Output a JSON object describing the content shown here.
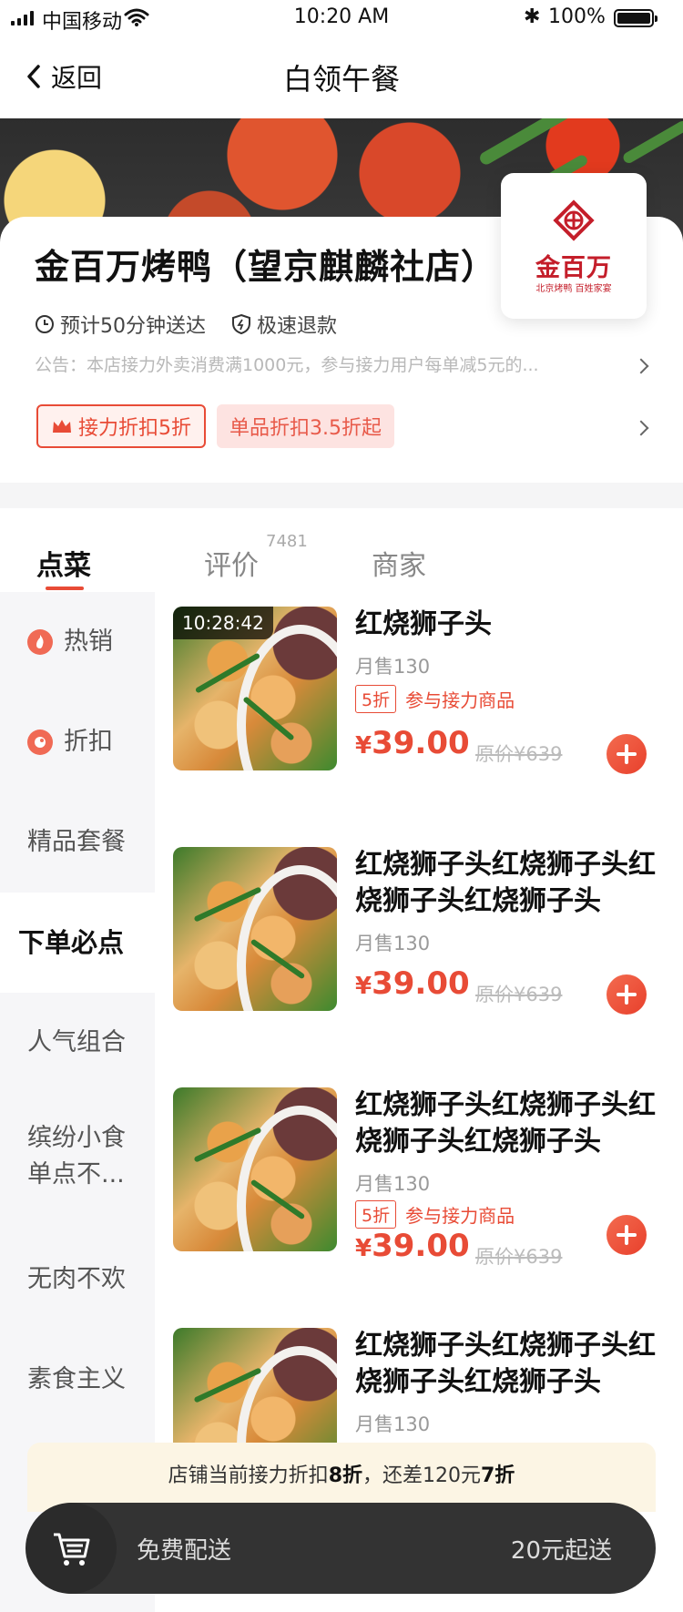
{
  "status_bar": {
    "carrier": "中国移动",
    "time": "10:20 AM",
    "battery": "100%"
  },
  "nav": {
    "back_label": "返回",
    "title": "白领午餐"
  },
  "store": {
    "name": "金百万烤鸭（望京麒麟社店）",
    "logo_text": "金百万",
    "logo_sub": "北京烤鸭 百姓家宴",
    "delivery_time": "预计50分钟送达",
    "refund": "极速退款",
    "notice": "公告：本店接力外卖消费满1000元，参与接力用户每单减5元的...",
    "promo_relay": "接力折扣5折",
    "promo_item": "单品折扣3.5折起"
  },
  "tabs": {
    "order": "点菜",
    "reviews": "评价",
    "reviews_count": "7481",
    "merchant": "商家"
  },
  "sidebar": {
    "items": [
      {
        "label": "热销"
      },
      {
        "label": "折扣"
      },
      {
        "label": "精品套餐"
      },
      {
        "label": "下单必点"
      },
      {
        "label": "人气组合"
      },
      {
        "label": "缤纷小食单点不..."
      },
      {
        "label": "无肉不欢"
      },
      {
        "label": "素食主义"
      }
    ]
  },
  "dishes": [
    {
      "timestamp": "10:28:42",
      "name": "红烧狮子头",
      "sales": "月售130",
      "discount_box": "5折",
      "discount_text": "参与接力商品",
      "currency": "¥",
      "price": "39.00",
      "original": "原价¥639"
    },
    {
      "name": "红烧狮子头红烧狮子头红烧狮子头红烧狮子头",
      "sales": "月售130",
      "currency": "¥",
      "price": "39.00",
      "original": "原价¥639"
    },
    {
      "name": "红烧狮子头红烧狮子头红烧狮子头红烧狮子头",
      "sales": "月售130",
      "discount_box": "5折",
      "discount_text": "参与接力商品",
      "currency": "¥",
      "price": "39.00",
      "original": "原价¥639"
    },
    {
      "name": "红烧狮子头红烧狮子头红烧狮子头红烧狮子头",
      "sales": "月售130"
    }
  ],
  "tip": {
    "prefix": "店铺当前接力折扣",
    "current": "8折",
    "middle": "，还差120元",
    "next": "7折"
  },
  "cart": {
    "delivery": "免费配送",
    "minimum": "20元起送"
  },
  "colors": {
    "accent": "#e84b36",
    "cart_bar": "#333333",
    "tip_bg": "#fcf5e4"
  }
}
